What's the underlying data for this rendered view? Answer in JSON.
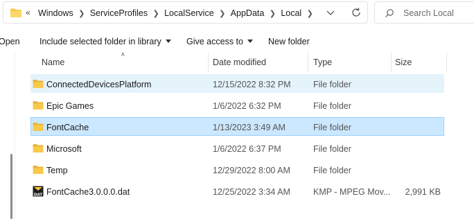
{
  "address": {
    "overflow": "«",
    "crumbs": [
      "Windows",
      "ServiceProfiles",
      "LocalService",
      "AppData",
      "Local"
    ]
  },
  "search": {
    "placeholder": "Search Local"
  },
  "toolbar": {
    "open": "Open",
    "include": "Include selected folder in library",
    "give_access": "Give access to",
    "new_folder": "New folder"
  },
  "columns": {
    "name": "Name",
    "date": "Date modified",
    "type": "Type",
    "size": "Size"
  },
  "files": [
    {
      "name": "ConnectedDevicesPlatform",
      "date": "12/15/2022 8:32 PM",
      "type": "File folder",
      "size": "",
      "icon": "folder-icon",
      "state": "hover"
    },
    {
      "name": "Epic Games",
      "date": "1/6/2022 6:32 PM",
      "type": "File folder",
      "size": "",
      "icon": "folder-icon",
      "state": ""
    },
    {
      "name": "FontCache",
      "date": "1/13/2023 3:49 AM",
      "type": "File folder",
      "size": "",
      "icon": "folder-icon",
      "state": "selected"
    },
    {
      "name": "Microsoft",
      "date": "1/6/2022 6:37 PM",
      "type": "File folder",
      "size": "",
      "icon": "folder-icon",
      "state": ""
    },
    {
      "name": "Temp",
      "date": "12/29/2022 8:00 AM",
      "type": "File folder",
      "size": "",
      "icon": "folder-icon",
      "state": ""
    },
    {
      "name": "FontCache3.0.0.0.dat",
      "date": "12/25/2022 3:34 AM",
      "type": "KMP - MPEG Mov...",
      "size": "2,991 KB",
      "icon": "dat-file-icon",
      "state": ""
    }
  ],
  "colors": {
    "folder": "#f8c94b",
    "selected": "#cce8ff",
    "hover": "#e5f3fb"
  }
}
